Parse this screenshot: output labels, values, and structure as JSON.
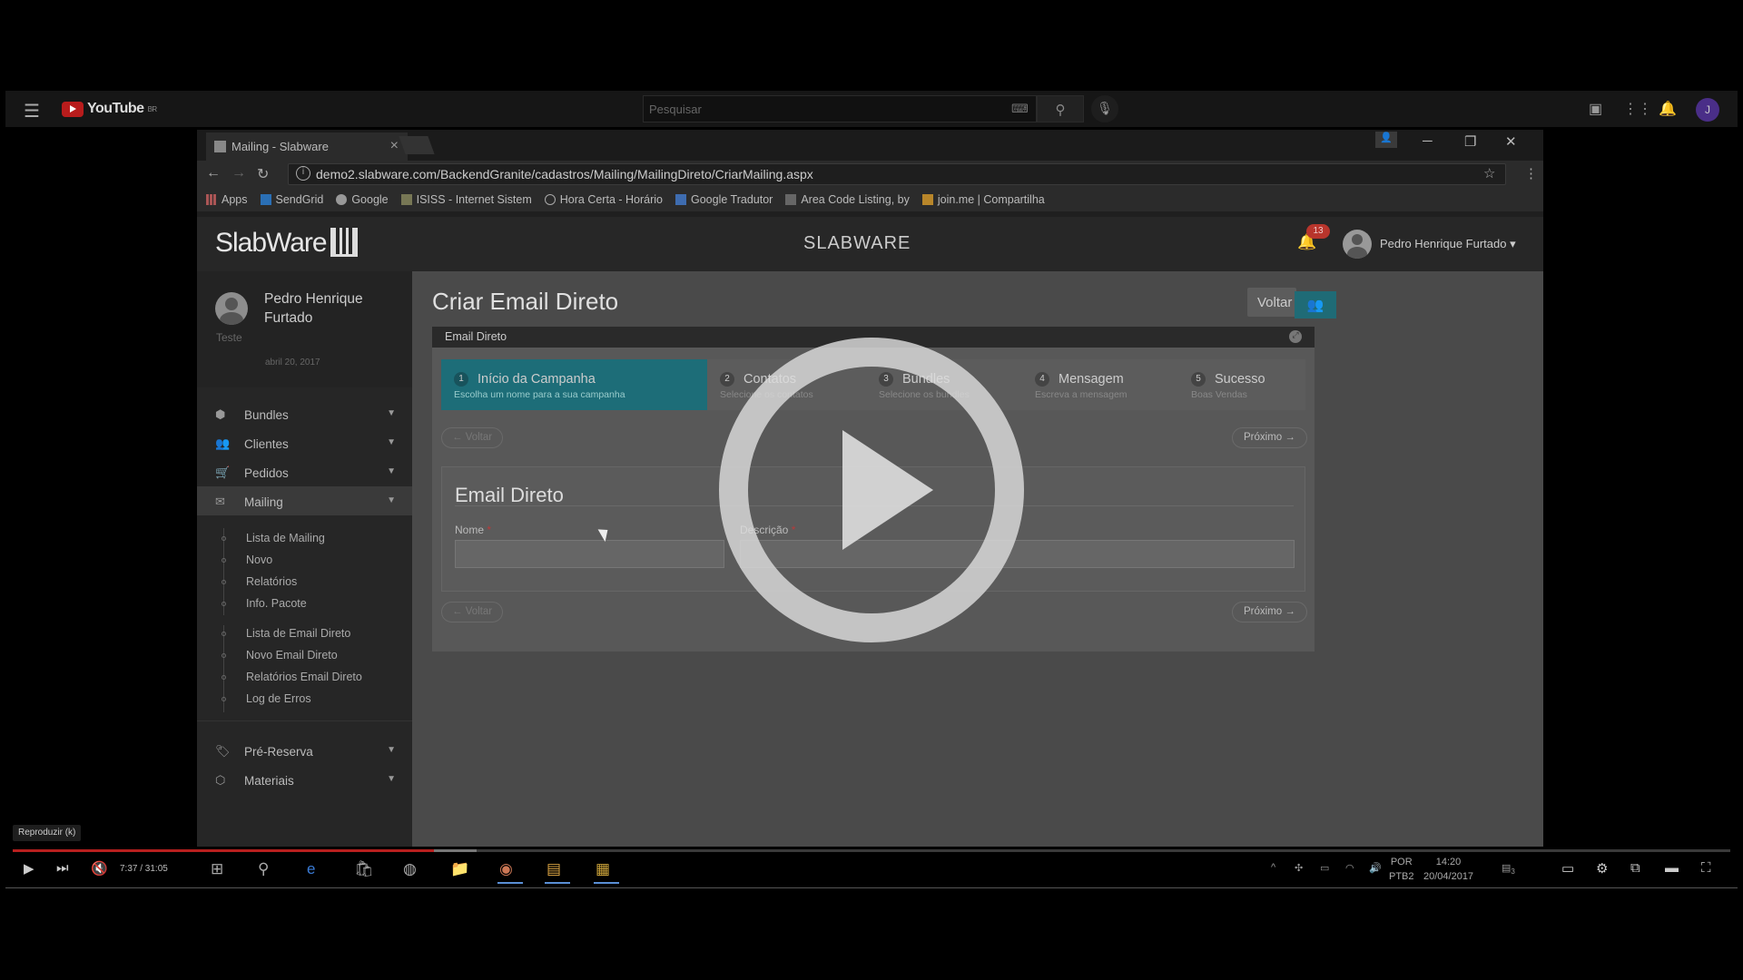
{
  "youtube": {
    "logo": "YouTube",
    "region": "BR",
    "search_placeholder": "Pesquisar",
    "avatar_letter": "J"
  },
  "browser": {
    "tab_title": "Mailing - Slabware",
    "url": "demo2.slabware.com/BackendGranite/cadastros/Mailing/MailingDireto/CriarMailing.aspx",
    "bookmarks": [
      "Apps",
      "SendGrid",
      "Google",
      "ISISS - Internet Sistem",
      "Hora Certa - Horário",
      "Google Tradutor",
      "Area Code Listing, by",
      "join.me | Compartilha"
    ]
  },
  "app": {
    "logo": "SlabWare",
    "brand": "SLABWARE",
    "notifications": "13",
    "user": "Pedro Henrique Furtado"
  },
  "sidebar": {
    "profile_name": "Pedro Henrique Furtado",
    "profile_role": "Teste",
    "profile_date": "abril 20, 2017",
    "menu": [
      {
        "label": "Bundles"
      },
      {
        "label": "Clientes"
      },
      {
        "label": "Pedidos"
      },
      {
        "label": "Mailing"
      },
      {
        "label": "Pré-Reserva"
      },
      {
        "label": "Materiais"
      }
    ],
    "mailing_sub_a": [
      "Lista de Mailing",
      "Novo",
      "Relatórios",
      "Info. Pacote"
    ],
    "mailing_sub_b": [
      "Lista de Email Direto",
      "Novo Email Direto",
      "Relatórios Email Direto",
      "Log de Erros"
    ]
  },
  "main": {
    "page_title": "Criar Email Direto",
    "back_button": "Voltar",
    "panel_title": "Email Direto",
    "steps": [
      {
        "num": "1",
        "title": "Início da Campanha",
        "desc": "Escolha um nome para a sua campanha"
      },
      {
        "num": "2",
        "title": "Contatos",
        "desc": "Selecione os contatos"
      },
      {
        "num": "3",
        "title": "Bundles",
        "desc": "Selecione os bundles"
      },
      {
        "num": "4",
        "title": "Mensagem",
        "desc": "Escreva a mensagem"
      },
      {
        "num": "5",
        "title": "Sucesso",
        "desc": "Boas Vendas"
      }
    ],
    "prev_label": "← Voltar",
    "next_label": "Próximo →",
    "form_title": "Email Direto",
    "name_label": "Nome",
    "desc_label": "Descrição",
    "required_mark": "*"
  },
  "player": {
    "tooltip": "Reproduzir (k)",
    "time": "7:37 / 31:05",
    "progress_fraction": 0.245,
    "buffer_fraction": 0.27
  },
  "taskbar": {
    "lang_line1": "POR",
    "lang_line2": "PTB2",
    "clock_time": "14:20",
    "clock_date": "20/04/2017",
    "notif_count": "3"
  }
}
